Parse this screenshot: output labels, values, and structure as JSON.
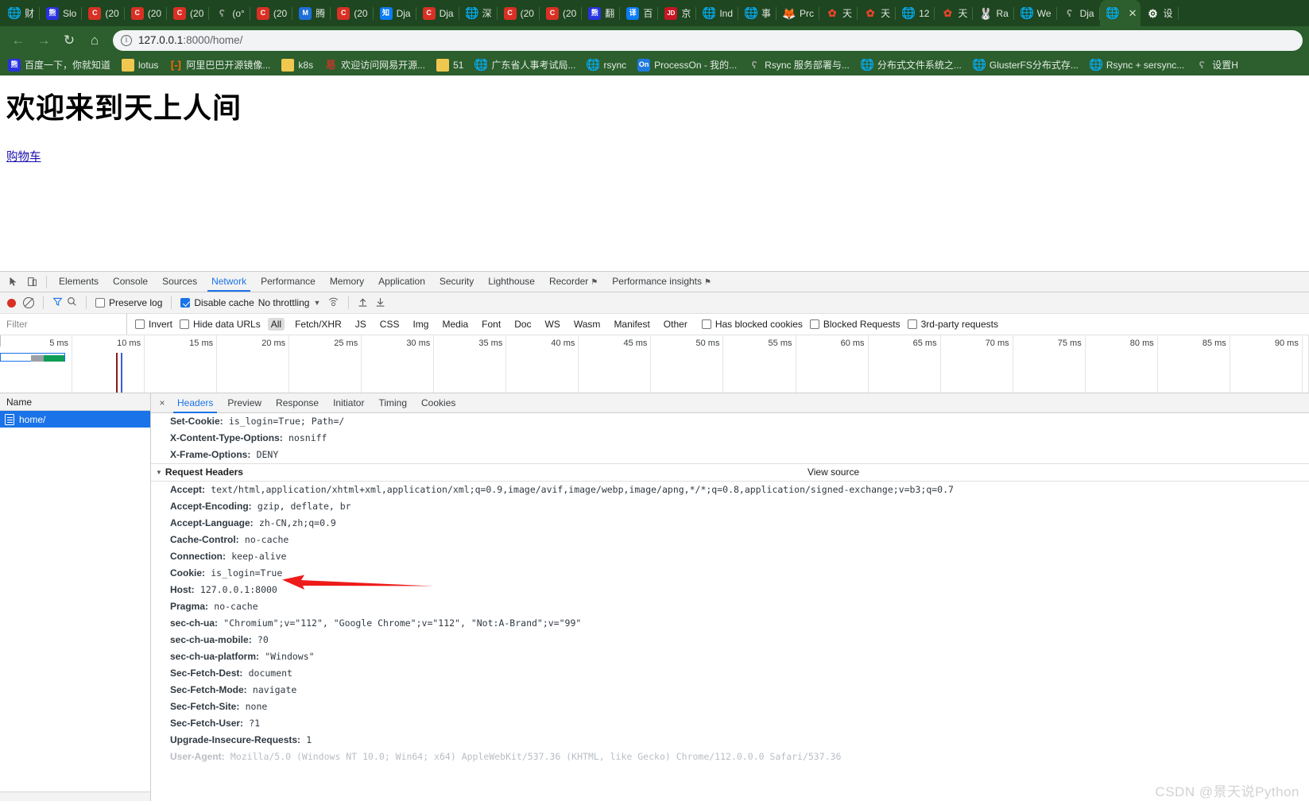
{
  "browser": {
    "tabs": [
      {
        "label": "财",
        "icon": "globe-icon"
      },
      {
        "label": "Slo",
        "icon": "baidu-icon"
      },
      {
        "label": "(20",
        "icon": "csdn-icon"
      },
      {
        "label": "(20",
        "icon": "csdn-icon"
      },
      {
        "label": "(20",
        "icon": "csdn-icon"
      },
      {
        "label": "(o°",
        "icon": "django-icon"
      },
      {
        "label": "(20",
        "icon": "csdn-icon"
      },
      {
        "label": "腾",
        "icon": "tencent-icon"
      },
      {
        "label": "(20",
        "icon": "csdn-icon"
      },
      {
        "label": "Dja",
        "icon": "zhihu-icon"
      },
      {
        "label": "Dja",
        "icon": "csdn-icon"
      },
      {
        "label": "深",
        "icon": "globe-icon"
      },
      {
        "label": "(20",
        "icon": "csdn-icon"
      },
      {
        "label": "(20",
        "icon": "csdn-icon"
      },
      {
        "label": "翻",
        "icon": "baidu-icon"
      },
      {
        "label": "百",
        "icon": "translate-icon"
      },
      {
        "label": "京",
        "icon": "jd-icon"
      },
      {
        "label": "Ind",
        "icon": "globe-icon"
      },
      {
        "label": "事",
        "icon": "globe-icon"
      },
      {
        "label": "Prc",
        "icon": "gitlab-icon"
      },
      {
        "label": "天",
        "icon": "flower-icon"
      },
      {
        "label": "天",
        "icon": "flower-icon"
      },
      {
        "label": "12",
        "icon": "globe-icon"
      },
      {
        "label": "天",
        "icon": "flower-icon"
      },
      {
        "label": "Ra",
        "icon": "rabbitmq-icon"
      },
      {
        "label": "We",
        "icon": "globe-icon"
      },
      {
        "label": "Dja",
        "icon": "django-icon"
      }
    ],
    "active_tab": {
      "label": "",
      "close_label": "✕",
      "icon": "globe-icon"
    },
    "settings_tab_label": "设",
    "nav": {
      "back": "←",
      "forward": "→",
      "reload": "↻",
      "home": "⌂"
    },
    "omnibox": {
      "host": "127.0.0.1",
      "path": ":8000/home/",
      "info_icon": "info-icon"
    },
    "bookmarks": [
      {
        "label": "百度一下，你就知道",
        "icon": "baidu-icon"
      },
      {
        "label": "lotus",
        "icon": "folder-icon"
      },
      {
        "label": "阿里巴巴开源镜像...",
        "icon": "alibaba-icon"
      },
      {
        "label": "k8s",
        "icon": "folder-icon"
      },
      {
        "label": "欢迎访问网易开源...",
        "icon": "netease-icon"
      },
      {
        "label": "51",
        "icon": "folder-icon"
      },
      {
        "label": "广东省人事考试局...",
        "icon": "globe-icon"
      },
      {
        "label": "rsync",
        "icon": "globe-icon"
      },
      {
        "label": "ProcessOn - 我的...",
        "icon": "processon-icon"
      },
      {
        "label": "Rsync 服务部署与...",
        "icon": "django-icon"
      },
      {
        "label": "分布式文件系统之...",
        "icon": "globe-icon"
      },
      {
        "label": "GlusterFS分布式存...",
        "icon": "globe-icon"
      },
      {
        "label": "Rsync + sersync...",
        "icon": "globe-icon"
      },
      {
        "label": "设置H",
        "icon": "django-icon"
      }
    ]
  },
  "page": {
    "heading": "欢迎来到天上人间",
    "cart_link": "购物车"
  },
  "devtools": {
    "panel_tabs": [
      {
        "label": "Elements",
        "selected": false
      },
      {
        "label": "Console",
        "selected": false
      },
      {
        "label": "Sources",
        "selected": false
      },
      {
        "label": "Network",
        "selected": true
      },
      {
        "label": "Performance",
        "selected": false
      },
      {
        "label": "Memory",
        "selected": false
      },
      {
        "label": "Application",
        "selected": false
      },
      {
        "label": "Security",
        "selected": false
      },
      {
        "label": "Lighthouse",
        "selected": false
      },
      {
        "label": "Recorder",
        "selected": false,
        "badge": "⚑"
      },
      {
        "label": "Performance insights",
        "selected": false,
        "badge": "⚑"
      }
    ],
    "network_toolbar": {
      "record_icon": "record-icon",
      "clear_icon": "clear-icon",
      "filter_icon": "filter-funnel-icon",
      "search_icon": "search-icon",
      "preserve_log_label": "Preserve log",
      "preserve_log_checked": false,
      "disable_cache_label": "Disable cache",
      "disable_cache_checked": true,
      "throttling_label": "No throttling",
      "wifi_icon": "wifi-settings-icon",
      "import_icon": "import-har-icon",
      "export_icon": "export-har-icon"
    },
    "filter_row": {
      "filter_placeholder": "Filter",
      "invert_label": "Invert",
      "hide_data_urls_label": "Hide data URLs",
      "types": [
        "All",
        "Fetch/XHR",
        "JS",
        "CSS",
        "Img",
        "Media",
        "Font",
        "Doc",
        "WS",
        "Wasm",
        "Manifest",
        "Other"
      ],
      "selected_type": "All",
      "has_blocked_cookies_label": "Has blocked cookies",
      "blocked_requests_label": "Blocked Requests",
      "third_party_label": "3rd-party requests"
    },
    "timeline_ticks": [
      "5 ms",
      "10 ms",
      "15 ms",
      "20 ms",
      "25 ms",
      "30 ms",
      "35 ms",
      "40 ms",
      "45 ms",
      "50 ms",
      "55 ms",
      "60 ms",
      "65 ms",
      "70 ms",
      "75 ms",
      "80 ms",
      "85 ms",
      "90 ms"
    ],
    "requests": {
      "column_header": "Name",
      "rows": [
        {
          "name": "home/",
          "selected": true,
          "icon": "document-icon"
        }
      ]
    },
    "detail": {
      "close_icon": "×",
      "tabs": [
        {
          "label": "Headers",
          "selected": true
        },
        {
          "label": "Preview",
          "selected": false
        },
        {
          "label": "Response",
          "selected": false
        },
        {
          "label": "Initiator",
          "selected": false
        },
        {
          "label": "Timing",
          "selected": false
        },
        {
          "label": "Cookies",
          "selected": false
        }
      ],
      "response_headers_visible": [
        {
          "key": "Set-Cookie:",
          "value": "is_login=True; Path=/"
        },
        {
          "key": "X-Content-Type-Options:",
          "value": "nosniff"
        },
        {
          "key": "X-Frame-Options:",
          "value": "DENY"
        }
      ],
      "request_headers_section": {
        "title": "Request Headers",
        "view_source": "View source",
        "expanded": true
      },
      "request_headers": [
        {
          "key": "Accept:",
          "value": "text/html,application/xhtml+xml,application/xml;q=0.9,image/avif,image/webp,image/apng,*/*;q=0.8,application/signed-exchange;v=b3;q=0.7"
        },
        {
          "key": "Accept-Encoding:",
          "value": "gzip, deflate, br"
        },
        {
          "key": "Accept-Language:",
          "value": "zh-CN,zh;q=0.9"
        },
        {
          "key": "Cache-Control:",
          "value": "no-cache"
        },
        {
          "key": "Connection:",
          "value": "keep-alive"
        },
        {
          "key": "Cookie:",
          "value": "is_login=True"
        },
        {
          "key": "Host:",
          "value": "127.0.0.1:8000"
        },
        {
          "key": "Pragma:",
          "value": "no-cache"
        },
        {
          "key": "sec-ch-ua:",
          "value": "\"Chromium\";v=\"112\", \"Google Chrome\";v=\"112\", \"Not:A-Brand\";v=\"99\""
        },
        {
          "key": "sec-ch-ua-mobile:",
          "value": "?0"
        },
        {
          "key": "sec-ch-ua-platform:",
          "value": "\"Windows\""
        },
        {
          "key": "Sec-Fetch-Dest:",
          "value": "document"
        },
        {
          "key": "Sec-Fetch-Mode:",
          "value": "navigate"
        },
        {
          "key": "Sec-Fetch-Site:",
          "value": "none"
        },
        {
          "key": "Sec-Fetch-User:",
          "value": "?1"
        },
        {
          "key": "Upgrade-Insecure-Requests:",
          "value": "1"
        },
        {
          "key": "User-Agent:",
          "value": "Mozilla/5.0 (Windows NT 10.0; Win64; x64) AppleWebKit/537.36 (KHTML, like Gecko) Chrome/112.0.0.0 Safari/537.36"
        }
      ]
    }
  },
  "annotation": {
    "arrow_color": "#ee1b1b",
    "points_at": "Cookie: is_login=True"
  },
  "watermark": "CSDN @景天说Python",
  "colors": {
    "chrome_dark_green": "#1e4620",
    "chrome_green": "#2c5e2e",
    "devtools_accent": "#1a73e8",
    "link": "#1a0dab",
    "selected_row": "#1a73e8"
  }
}
